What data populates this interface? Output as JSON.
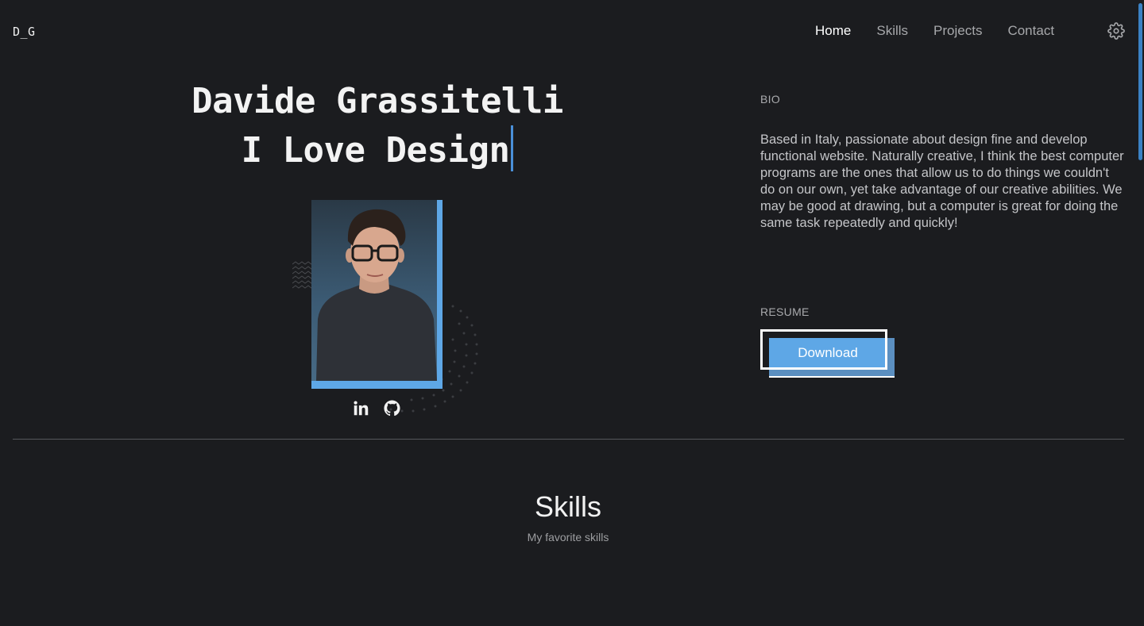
{
  "header": {
    "logo": "D_G",
    "nav": [
      {
        "label": "Home",
        "active": true
      },
      {
        "label": "Skills",
        "active": false
      },
      {
        "label": "Projects",
        "active": false
      },
      {
        "label": "Contact",
        "active": false
      }
    ],
    "settings_icon": "gear-icon"
  },
  "hero": {
    "name": "Davide Grassitelli",
    "tagline": "I Love Design",
    "photo_icon": "portrait-photo",
    "socials": [
      {
        "icon": "linkedin-icon"
      },
      {
        "icon": "github-icon"
      }
    ]
  },
  "bio": {
    "label": "BIO",
    "text": "Based in Italy, passionate about design fine and develop functional website. Naturally creative, I think the best computer programs are the ones that allow us to do things we couldn't do on our own, yet take advantage of our creative abilities. We may be good at drawing, but a computer is great for doing the same task repeatedly and quickly!"
  },
  "resume": {
    "label": "RESUME",
    "button_label": "Download"
  },
  "skills": {
    "title": "Skills",
    "subtitle": "My favorite skills"
  },
  "colors": {
    "background": "#1b1c1f",
    "accent": "#5ea7e6"
  }
}
